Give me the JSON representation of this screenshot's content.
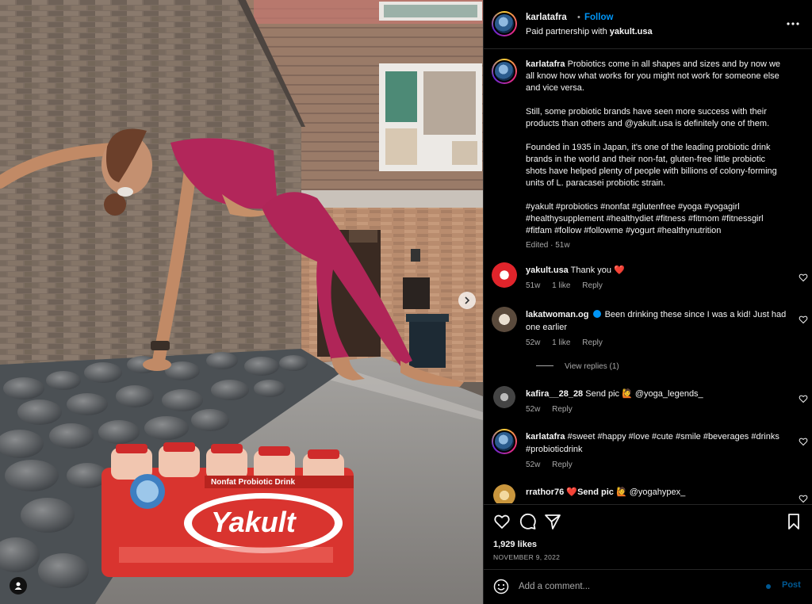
{
  "header": {
    "username": "karlatafra",
    "dot": "•",
    "follow": "Follow",
    "partnership_prefix": "Paid partnership with",
    "partner": "yakult.usa"
  },
  "product": {
    "brand": "Yakult",
    "banner": "Nonfat Probiotic Drink"
  },
  "caption": {
    "username": "karlatafra",
    "p1": "Probiotics come in all shapes and sizes and by now we all know how what works for you might not work for someone else and vice versa.",
    "p2": "Still, some probiotic brands have seen more success with their products than others and @yakult.usa is definitely one of them.",
    "p3": "Founded in 1935 in Japan, it's one of the leading probiotic drink brands in the world and their non-fat, gluten-free little probiotic shots have helped plenty of people with billions of colony-forming units of L. paracasei probiotic strain.",
    "p4": "#yakult #probiotics #nonfat #glutenfree #yoga #yogagirl #healthysupplement #healthydiet #fitness #fitmom #fitnessgirl #fitfam #follow #followme #yogurt #healthynutrition",
    "edited": "Edited · 51w"
  },
  "comments": [
    {
      "username": "yakult.usa",
      "text": "Thank you",
      "emoji": "❤️",
      "age": "51w",
      "likes": "1 like",
      "reply": "Reply"
    },
    {
      "username": "lakatwoman.og",
      "text": "Been drinking these since I was a kid! Just had one earlier",
      "age": "52w",
      "likes": "1 like",
      "reply": "Reply",
      "view_replies": "View replies (1)"
    },
    {
      "username": "kafira__28_28",
      "text": "Send pic",
      "emoji": "🙋",
      "mention": "@yoga_legends_",
      "age": "52w",
      "reply": "Reply"
    },
    {
      "username": "karlatafra",
      "text": "#sweet #happy #love #cute #smile #beverages #drinks #probioticdrink",
      "age": "52w",
      "reply": "Reply"
    },
    {
      "username": "rrathor76",
      "emoji1": "❤️",
      "text": "Send pic",
      "emoji2": "🙋",
      "mention": "@yogahypex_"
    }
  ],
  "footer": {
    "likes": "1,929 likes",
    "date": "NOVEMBER 9, 2022",
    "comment_placeholder": "Add a comment...",
    "post": "Post"
  },
  "icons": {
    "more": "more-horizontal-icon",
    "heart": "heart-icon",
    "comment": "comment-icon",
    "share": "send-icon",
    "save": "bookmark-icon",
    "emoji": "emoji-icon",
    "next": "chevron-right-icon",
    "tag": "user-tag-icon"
  },
  "colors": {
    "accent": "#0095f6",
    "background": "#000000",
    "text": "#f5f5f5",
    "muted": "#a8a8a8",
    "like": "#ed4956"
  }
}
